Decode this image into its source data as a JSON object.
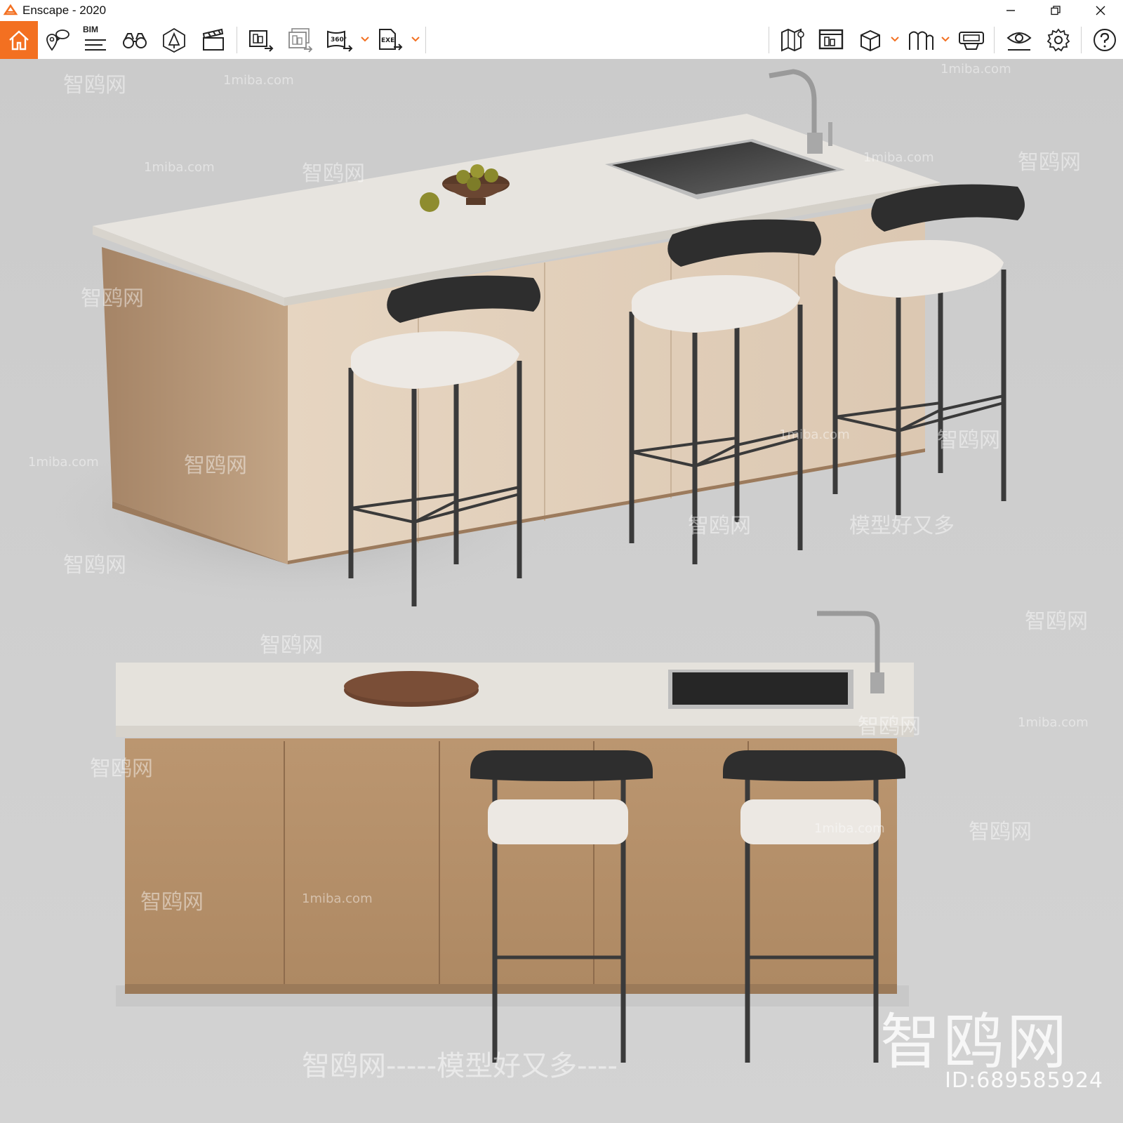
{
  "window": {
    "title": "Enscape - 2020",
    "controls": [
      "minimize-icon",
      "restore-icon",
      "close-icon"
    ]
  },
  "toolbar": {
    "accent_color": "#f37021",
    "bim_label": "BIM",
    "buttons": [
      {
        "id": "home",
        "icon": "home-icon"
      },
      {
        "id": "views",
        "icon": "map-pin-chat-icon"
      },
      {
        "id": "bim",
        "icon": "bim-list-icon"
      },
      {
        "id": "binoculars",
        "icon": "binoculars-icon"
      },
      {
        "id": "atmosphere",
        "icon": "cone-tree-icon"
      },
      {
        "id": "video",
        "icon": "clapperboard-icon"
      },
      {
        "id": "render-image",
        "icon": "render-image-icon"
      },
      {
        "id": "batch-render",
        "icon": "batch-render-icon"
      },
      {
        "id": "panorama",
        "icon": "panorama-360-icon"
      },
      {
        "id": "exe-export",
        "icon": "exe-export-icon"
      },
      {
        "id": "map",
        "icon": "map-icon"
      },
      {
        "id": "capture-manager",
        "icon": "capture-manager-icon"
      },
      {
        "id": "asset-library",
        "icon": "cube-icon"
      },
      {
        "id": "web-standalone",
        "icon": "building-icon"
      },
      {
        "id": "vr",
        "icon": "vr-headset-icon"
      },
      {
        "id": "visual-settings",
        "icon": "eye-icon"
      },
      {
        "id": "settings",
        "icon": "gear-icon"
      },
      {
        "id": "help",
        "icon": "help-icon"
      }
    ]
  },
  "viewport": {
    "watermark_site": "1miba.com",
    "watermark_cn": "智鸥网",
    "watermark_slogan": "模型好又多",
    "watermark_dash": "———",
    "watermark_big": "智鸥网",
    "watermark_id": "ID:689585924",
    "watermark_bottom": "智鸥网-----模型好又多----"
  },
  "colors": {
    "background": "#c9c9c9",
    "countertop": "#e5e2dc",
    "cabinet_light": "#e4d3bf",
    "cabinet_dark": "#b48f6a",
    "stool_frame": "#3a3a3a",
    "stool_back": "#2e2e2e",
    "stool_seat": "#ece8e3"
  }
}
